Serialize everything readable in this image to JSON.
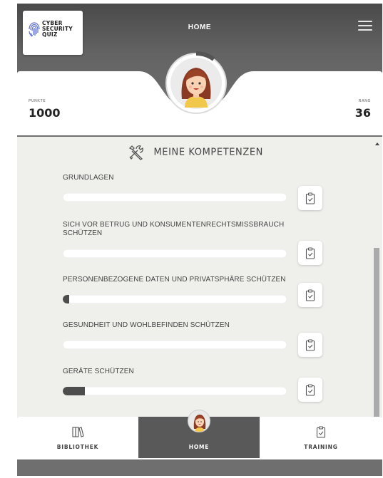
{
  "app": {
    "logo_text_1": "CYBER",
    "logo_text_2": "SECURITY",
    "logo_text_3": "QUIZ",
    "nav_title": "HOME"
  },
  "stats": {
    "punkte_label": "PUNKTE",
    "punkte_value": "1000",
    "rang_label": "RANG",
    "rang_value": "36"
  },
  "avatar": {
    "progress_fraction": 0.1
  },
  "competences": {
    "title": "MEINE KOMPETENZEN",
    "items": [
      {
        "label": "GRUNDLAGEN",
        "progress": 0
      },
      {
        "label": "SICH VOR BETRUG UND KONSUMENTENRECHTSMISSBRAUCH SCHÜTZEN",
        "progress": 0
      },
      {
        "label": "PERSONENBEZOGENE DATEN UND PRIVATSPHÄRE SCHÜTZEN",
        "progress": 0.03
      },
      {
        "label": "GESUNDHEIT UND WOHLBEFINDEN SCHÜTZEN",
        "progress": 0
      },
      {
        "label": "GERÄTE SCHÜTZEN",
        "progress": 0.1
      }
    ]
  },
  "footer": {
    "tabs": [
      {
        "label": "BIBLIOTHEK",
        "icon": "books-icon",
        "active": false
      },
      {
        "label": "HOME",
        "icon": "avatar-icon",
        "active": true
      },
      {
        "label": "TRAINING",
        "icon": "clipboard-icon",
        "active": false
      }
    ]
  },
  "colors": {
    "header_bg": "#4a4a4a",
    "active_tab": "#595959",
    "bar_fill": "#4d4d4d",
    "content_bg": "#efefec"
  }
}
